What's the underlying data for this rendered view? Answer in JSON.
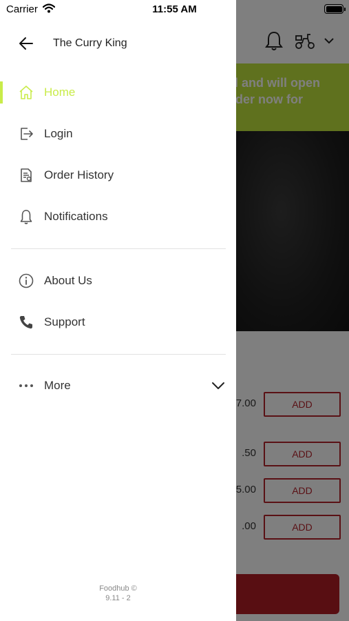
{
  "status_bar": {
    "carrier": "Carrier",
    "time": "11:55 AM"
  },
  "drawer": {
    "store_name": "The Curry King",
    "menu": [
      {
        "label": "Home",
        "icon": "home-icon",
        "active": true
      },
      {
        "label": "Login",
        "icon": "login-icon"
      },
      {
        "label": "Order History",
        "icon": "order-history-icon"
      },
      {
        "label": "Notifications",
        "icon": "bell-icon"
      },
      {
        "label": "About Us",
        "icon": "info-icon"
      },
      {
        "label": "Support",
        "icon": "phone-icon"
      },
      {
        "label": "More",
        "icon": "more-dots-icon"
      }
    ],
    "footer": {
      "brand": "Foodhub ©",
      "version": "9.11 - 2"
    }
  },
  "background": {
    "banner_text_line1": "d and will open",
    "banner_text_line2": "rder now for",
    "items": [
      {
        "price": "7.00",
        "button": "ADD"
      },
      {
        "price": ".50",
        "button": "ADD"
      },
      {
        "price": "5.00",
        "button": "ADD"
      },
      {
        "price": ".00",
        "button": "ADD"
      }
    ]
  },
  "colors": {
    "accent": "#c9ec4a",
    "banner": "#bfe33c",
    "brand_red": "#b5222b"
  }
}
